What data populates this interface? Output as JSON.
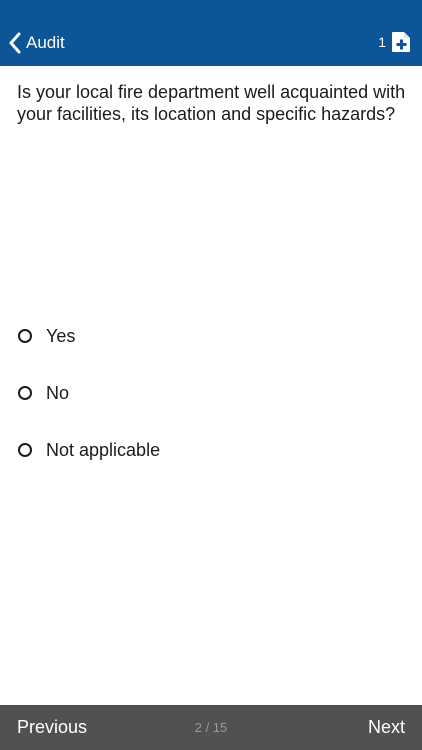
{
  "header": {
    "back_label": "Audit",
    "count": "1",
    "back_icon": "chevron-left-icon",
    "add_icon": "add-document-icon",
    "background_color": "#0c5596"
  },
  "question": {
    "text": "Is your local fire department well acquainted with your facilities, its location and specific hazards?"
  },
  "options": [
    {
      "label": "Yes",
      "selected": false
    },
    {
      "label": "No",
      "selected": false
    },
    {
      "label": "Not applicable",
      "selected": false
    }
  ],
  "footer": {
    "previous_label": "Previous",
    "page_indicator": "2 / 15",
    "next_label": "Next",
    "background_color": "#515151"
  }
}
